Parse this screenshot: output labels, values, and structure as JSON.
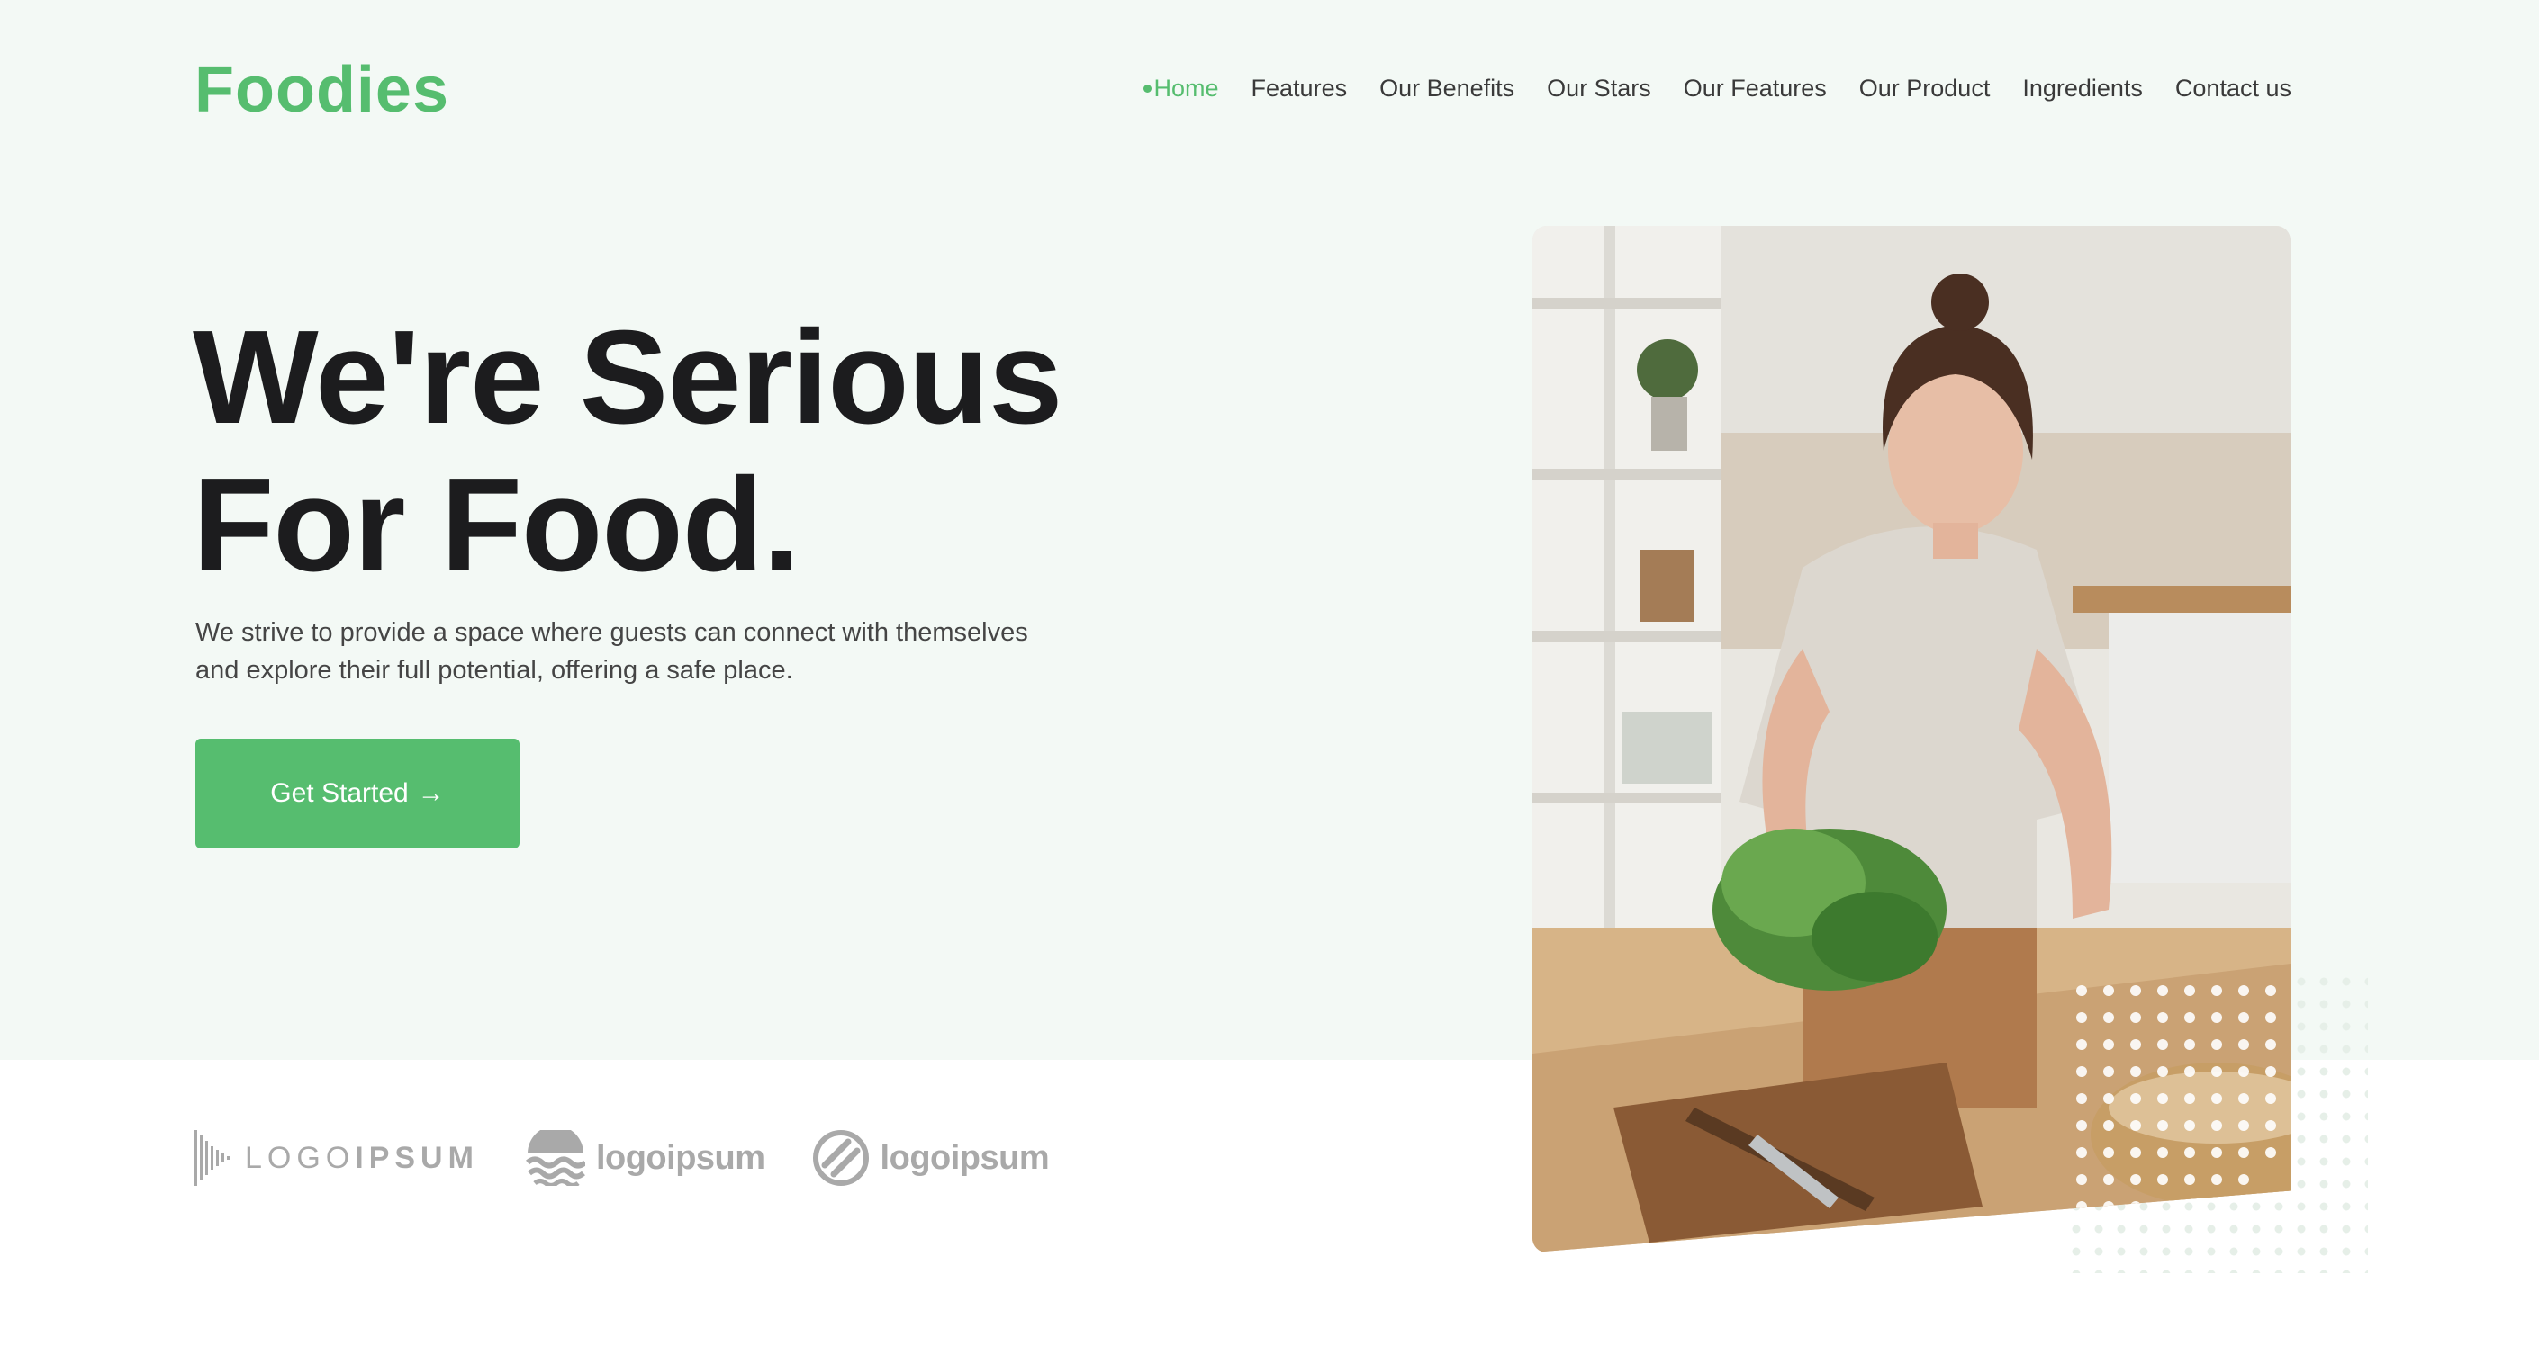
{
  "brand": {
    "name": "Foodies",
    "color": "#56bd6f"
  },
  "nav": {
    "items": [
      {
        "label": "Home",
        "active": true
      },
      {
        "label": "Features"
      },
      {
        "label": "Our Benefits"
      },
      {
        "label": "Our Stars"
      },
      {
        "label": "Our Features"
      },
      {
        "label": "Our Product"
      },
      {
        "label": "Ingredients"
      },
      {
        "label": "Contact us"
      }
    ]
  },
  "hero": {
    "headline_line1": "We're Serious",
    "headline_line2": "For Food.",
    "subtitle": "We strive to provide a space where guests can connect with themselves and explore their full potential, offering a safe place.",
    "cta_label": "Get Started",
    "cta_arrow": "→",
    "image_alt": "Woman in kitchen holding fresh lettuce"
  },
  "partners": [
    {
      "name_light": "LOGO",
      "name_bold": "IPSUM",
      "icon": "soundwave-icon"
    },
    {
      "name": "logoipsum",
      "icon": "waves-icon"
    },
    {
      "name": "logoipsum",
      "icon": "circle-stripes-icon"
    }
  ],
  "colors": {
    "accent": "#56bd6f",
    "hero_bg": "#f3f9f5",
    "heading": "#1c1c1e",
    "body_text": "#454545",
    "logo_gray": "#a9a9a9"
  }
}
